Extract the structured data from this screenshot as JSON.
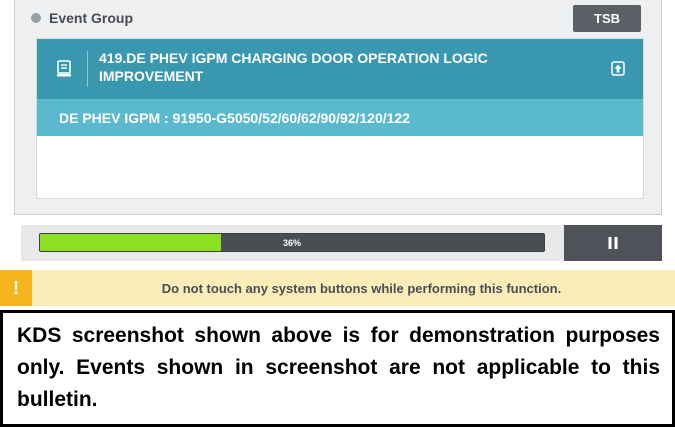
{
  "event_group": {
    "title": "Event Group",
    "tsb_label": "TSB"
  },
  "event": {
    "title": "419.DE PHEV IGPM CHARGING DOOR OPERATION LOGIC IMPROVEMENT",
    "detail": "DE PHEV IGPM : 91950-G5050/52/60/62/90/92/120/122",
    "doc_icon": "document-icon",
    "expand_icon": "expand-icon"
  },
  "progress": {
    "percent_label": "36%",
    "value": 0.36,
    "pause_icon": "pause-icon"
  },
  "warning": {
    "icon_text": "!",
    "message": "Do not touch any system buttons while performing this function."
  },
  "caption": {
    "text": "KDS screenshot shown above is for demonstration purposes only. Events shown in screenshot are not applicable to this bulletin."
  },
  "colors": {
    "event_header": "#3a97b0",
    "event_sub": "#5bb9cf",
    "progress_fill": "#8be01f",
    "warning_bg": "#fbedba",
    "warning_icon": "#f6b51e"
  }
}
